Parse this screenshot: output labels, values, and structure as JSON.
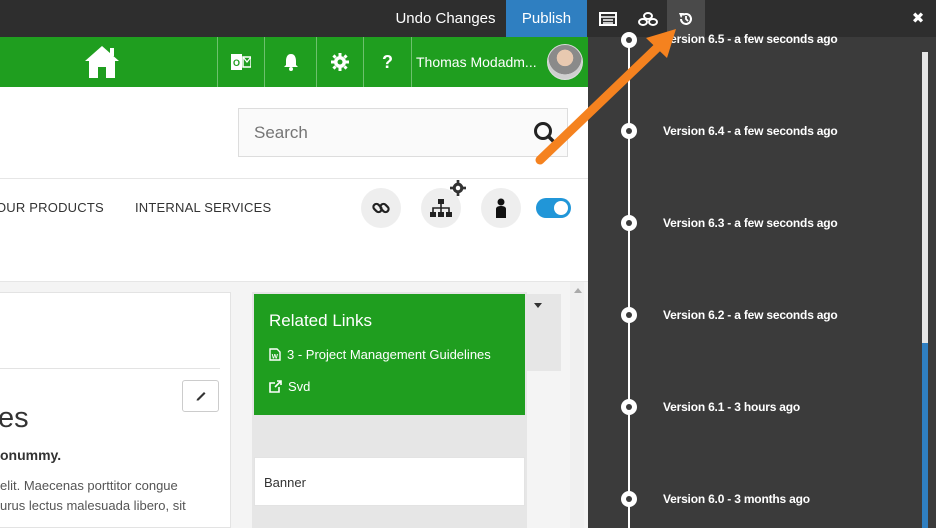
{
  "toolbar": {
    "undo_label": "Undo Changes",
    "publish_label": "Publish",
    "close_label": "✖",
    "icons": [
      "list-icon",
      "layers-icon",
      "history-icon"
    ]
  },
  "header": {
    "home_icon": "home-icon",
    "apps": [
      "outlook-icon",
      "bell-icon",
      "gear-icon",
      "help-icon"
    ],
    "help_label": "?",
    "username": "Thomas Modadm..."
  },
  "search": {
    "placeholder": "Search"
  },
  "nav": {
    "items": [
      "OUR PRODUCTS",
      "INTERNAL SERVICES"
    ],
    "tools": [
      "link-icon",
      "sitemap-icon",
      "person-icon"
    ],
    "toggle_on": true
  },
  "content": {
    "title": "es",
    "subtitle": "onummy.",
    "body_lines": [
      "elit. Maecenas porttitor congue",
      "urus lectus malesuada libero, sit"
    ]
  },
  "related_links": {
    "title": "Related Links",
    "items": [
      {
        "label": "3 - Project Management Guidelines",
        "icon": "word-doc-icon"
      },
      {
        "label": "Svd",
        "icon": "external-link-icon"
      }
    ]
  },
  "banner": {
    "label": "Banner"
  },
  "versions": [
    {
      "label": "Version 6.5 - a few seconds ago"
    },
    {
      "label": "Version 6.4 - a few seconds ago"
    },
    {
      "label": "Version 6.3 - a few seconds ago"
    },
    {
      "label": "Version 6.2 - a few seconds ago"
    },
    {
      "label": "Version 6.1 - 3 hours ago"
    },
    {
      "label": "Version 6.0 - 3 months ago"
    }
  ],
  "colors": {
    "toolbar": "#2e2e2e",
    "publish": "#2f7fc1",
    "brand_green": "#1f9e1f",
    "panel": "#3b3b3b",
    "annotation_arrow": "#f5821f",
    "toggle": "#2196d8"
  }
}
